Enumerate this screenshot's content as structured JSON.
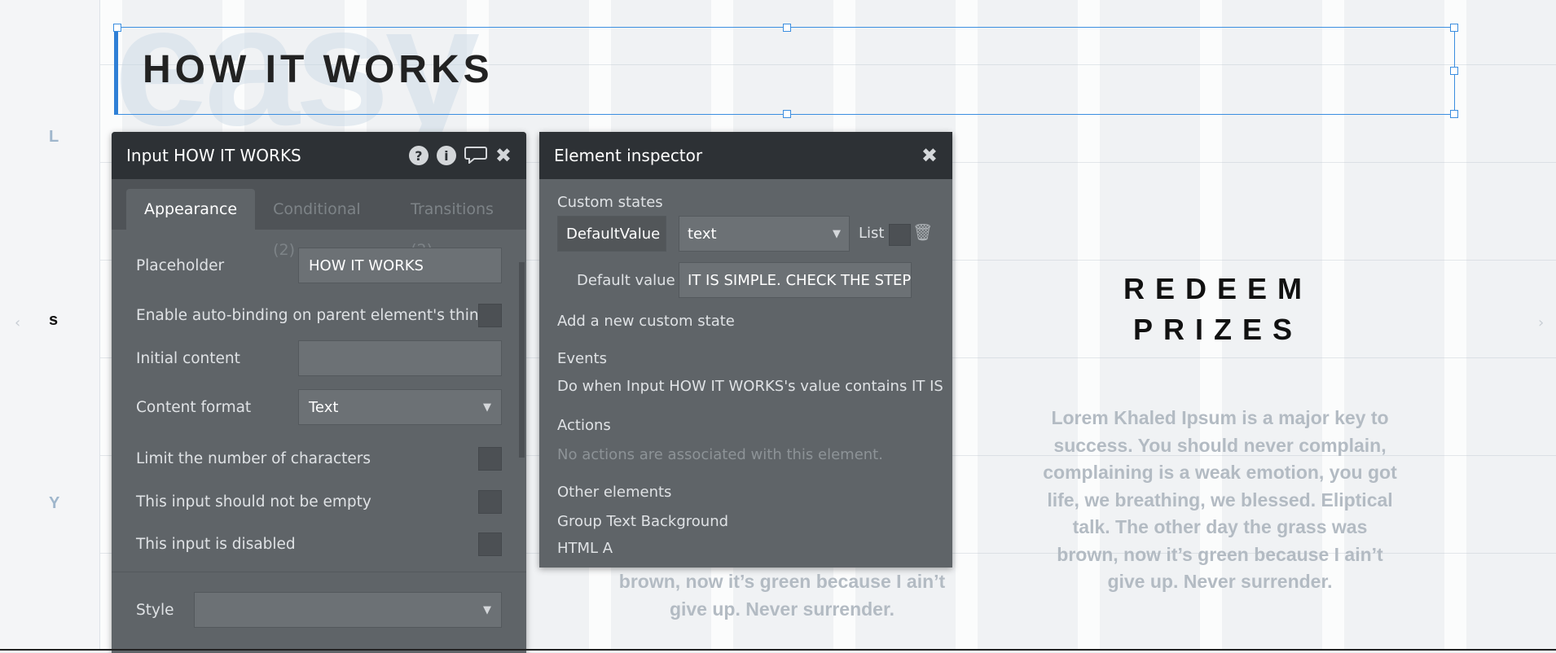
{
  "canvas": {
    "gutter_letters": [
      "L",
      "s",
      "Y"
    ],
    "background_word": "easy",
    "heading": "HOW IT WORKS",
    "redeem_title": "REDEEM PRIZES",
    "lorem_right": "Lorem Khaled Ipsum is a major key to success. You should never complain, complaining is a weak emotion, you got life, we breathing, we blessed. Eliptical talk. The other day the grass was brown, now it’s green because I ain’t give up. Never surrender.",
    "lorem_mid": "brown, now it’s green because I ain’t give up. Never surrender."
  },
  "property_editor": {
    "title": "Input HOW IT WORKS",
    "tabs": [
      "Appearance",
      "Conditional (2)",
      "Transitions (2)"
    ],
    "placeholder_label": "Placeholder",
    "placeholder_value": "HOW IT WORKS",
    "auto_binding_label": "Enable auto-binding on parent element's thing",
    "initial_content_label": "Initial content",
    "initial_content_value": "",
    "content_format_label": "Content format",
    "content_format_value": "Text",
    "limit_chars_label": "Limit the number of characters",
    "not_empty_label": "This input should not be empty",
    "disabled_label": "This input is disabled",
    "style_label": "Style",
    "style_value": ""
  },
  "inspector": {
    "title": "Element inspector",
    "custom_states_label": "Custom states",
    "state_name": "DefaultValue",
    "state_type": "text",
    "list_label": "List",
    "default_value_label": "Default value",
    "default_value": "IT IS SIMPLE. CHECK THE STEPS B",
    "add_state_link": "Add a new custom state",
    "events_label": "Events",
    "event_item": "Do when Input HOW IT WORKS's value contains IT IS",
    "actions_label": "Actions",
    "actions_empty": "No actions are associated with this element.",
    "other_elements_label": "Other elements",
    "other_elements": [
      "Group Text Background",
      "HTML A"
    ]
  }
}
